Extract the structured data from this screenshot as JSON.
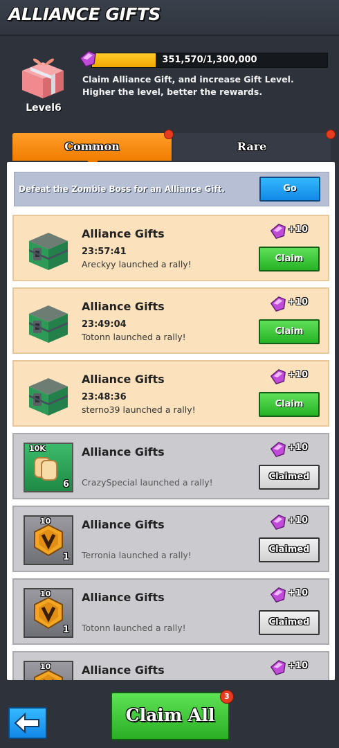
{
  "header": {
    "title": "ALLIANCE GIFTS"
  },
  "gift_level": {
    "level_label": "Level6",
    "progress_text": "351,570/1,300,000",
    "progress_fraction": 0.27,
    "description": "Claim Alliance Gift, and increase Gift Level. Higher the level, better the rewards."
  },
  "tabs": [
    {
      "label": "Common",
      "active": true
    },
    {
      "label": "Rare",
      "active": false
    }
  ],
  "boss_banner": {
    "text": "Defeat the Zombie Boss for an Alliance Gift.",
    "button": "Go"
  },
  "cards": [
    {
      "title": "Alliance Gifts",
      "time": "23:57:41",
      "subtitle": "Areckyy launched a rally!",
      "reward": "+10",
      "button": "Claim",
      "state": "active",
      "icon": "green-chest-icon"
    },
    {
      "title": "Alliance Gifts",
      "time": "23:49:04",
      "subtitle": "Totonn launched a rally!",
      "reward": "+10",
      "button": "Claim",
      "state": "active",
      "icon": "green-chest-icon"
    },
    {
      "title": "Alliance Gifts",
      "time": "23:48:36",
      "subtitle": "sterno39 launched a rally!",
      "reward": "+10",
      "button": "Claim",
      "state": "active",
      "icon": "green-chest-icon"
    },
    {
      "title": "Alliance Gifts",
      "time": "",
      "subtitle": "CrazySpecial launched a rally!",
      "reward": "+10",
      "button": "Claimed",
      "state": "claimed",
      "icon": "bread-icon",
      "icon_top": "10K",
      "icon_count": "6"
    },
    {
      "title": "Alliance Gifts",
      "time": "",
      "subtitle": "Terronia launched a rally!",
      "reward": "+10",
      "button": "Claimed",
      "state": "claimed",
      "icon": "speedup-badge-icon",
      "icon_top": "10",
      "icon_count": "1"
    },
    {
      "title": "Alliance Gifts",
      "time": "",
      "subtitle": "Totonn launched a rally!",
      "reward": "+10",
      "button": "Claimed",
      "state": "claimed",
      "icon": "speedup-badge-icon",
      "icon_top": "10",
      "icon_count": "1"
    },
    {
      "title": "Alliance Gifts",
      "time": "",
      "subtitle": "",
      "reward": "+10",
      "button": "",
      "state": "claimed",
      "icon": "speedup-badge-icon",
      "icon_top": "10",
      "icon_count": ""
    }
  ],
  "footer": {
    "claim_all": "Claim All",
    "badge": "3"
  },
  "colors": {
    "accent_orange": "#f07d00",
    "claim_green": "#26b224",
    "go_blue": "#1188e6",
    "gem_purple": "#c04bd8"
  }
}
